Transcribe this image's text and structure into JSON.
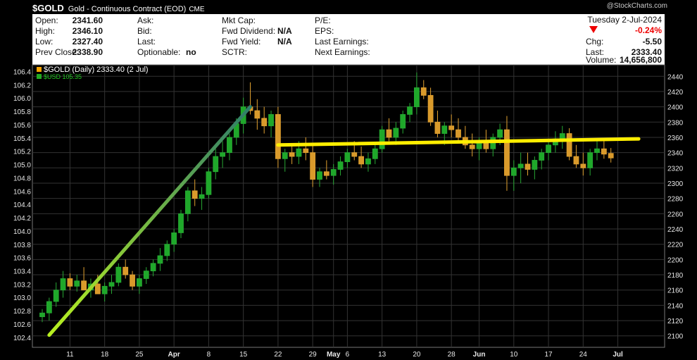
{
  "header": {
    "symbol": "$GOLD",
    "name": "Gold - Continuous Contract (EOD)",
    "exchange": "CME",
    "watermark": "@StockCharts.com"
  },
  "quote": {
    "open_label": "Open:",
    "open": "2341.60",
    "high_label": "High:",
    "high": "2346.10",
    "low_label": "Low:",
    "low": "2327.40",
    "prev_close_label": "Prev Close:",
    "prev_close": "2338.90",
    "ask_label": "Ask:",
    "bid_label": "Bid:",
    "last_label": "Last:",
    "optionable_label": "Optionable:",
    "optionable": "no",
    "mktcap_label": "Mkt Cap:",
    "fwd_div_label": "Fwd Dividend:",
    "fwd_div": "N/A",
    "fwd_yield_label": "Fwd Yield:",
    "fwd_yield": "N/A",
    "sctr_label": "SCTR:",
    "pe_label": "P/E:",
    "eps_label": "EPS:",
    "last_earnings_label": "Last Earnings:",
    "next_earnings_label": "Next Earnings:",
    "date": "Tuesday 2-Jul-2024",
    "pct_change": "-0.24%",
    "chg_label": "Chg:",
    "chg": "-5.50",
    "last_price_label": "Last:",
    "last_price": "2333.40",
    "volume_label": "Volume:",
    "volume": "14,656,800"
  },
  "chart_data": {
    "type": "candlestick",
    "legend": [
      {
        "name": "$GOLD (Daily) 2333.40 (2 Jul)",
        "color": "#ffffff"
      },
      {
        "name": "$USD 105.35",
        "color": "#22aa22"
      }
    ],
    "right_axis": {
      "ylim": [
        2085,
        2455
      ],
      "ticks": [
        2100,
        2120,
        2140,
        2160,
        2180,
        2200,
        2220,
        2240,
        2260,
        2280,
        2300,
        2320,
        2340,
        2360,
        2380,
        2400,
        2420,
        2440
      ]
    },
    "left_axis": {
      "ylim": [
        102.25,
        106.5
      ],
      "ticks": [
        "102.4",
        "102.6",
        "102.8",
        "103.0",
        "103.2",
        "103.4",
        "103.6",
        "103.8",
        "104.0",
        "104.2",
        "104.4",
        "104.6",
        "104.8",
        "105.0",
        "105.2",
        "105.4",
        "105.6",
        "105.8",
        "106.0",
        "106.2",
        "106.4"
      ]
    },
    "x_ticks": [
      {
        "label": "11",
        "idx": 4
      },
      {
        "label": "18",
        "idx": 9
      },
      {
        "label": "25",
        "idx": 14
      },
      {
        "label": "Apr",
        "idx": 19,
        "bold": true
      },
      {
        "label": "8",
        "idx": 24
      },
      {
        "label": "15",
        "idx": 29
      },
      {
        "label": "22",
        "idx": 34
      },
      {
        "label": "29",
        "idx": 39
      },
      {
        "label": "May",
        "idx": 42,
        "bold": true
      },
      {
        "label": "6",
        "idx": 44
      },
      {
        "label": "13",
        "idx": 49
      },
      {
        "label": "20",
        "idx": 54
      },
      {
        "label": "28",
        "idx": 59
      },
      {
        "label": "Jun",
        "idx": 63,
        "bold": true
      },
      {
        "label": "10",
        "idx": 68
      },
      {
        "label": "17",
        "idx": 73
      },
      {
        "label": "24",
        "idx": 78
      },
      {
        "label": "Jul",
        "idx": 83,
        "bold": true
      }
    ],
    "candles_gold": [
      [
        2125,
        2135,
        2118,
        2130
      ],
      [
        2130,
        2150,
        2120,
        2145
      ],
      [
        2145,
        2170,
        2138,
        2160
      ],
      [
        2160,
        2185,
        2150,
        2175
      ],
      [
        2175,
        2182,
        2160,
        2165
      ],
      [
        2165,
        2180,
        2158,
        2172
      ],
      [
        2172,
        2190,
        2165,
        2160
      ],
      [
        2160,
        2175,
        2150,
        2168
      ],
      [
        2168,
        2180,
        2160,
        2155
      ],
      [
        2155,
        2170,
        2145,
        2165
      ],
      [
        2165,
        2180,
        2155,
        2170
      ],
      [
        2170,
        2195,
        2165,
        2190
      ],
      [
        2190,
        2200,
        2175,
        2180
      ],
      [
        2180,
        2185,
        2160,
        2165
      ],
      [
        2165,
        2180,
        2155,
        2175
      ],
      [
        2175,
        2190,
        2168,
        2185
      ],
      [
        2185,
        2200,
        2178,
        2195
      ],
      [
        2195,
        2215,
        2185,
        2205
      ],
      [
        2205,
        2225,
        2198,
        2220
      ],
      [
        2220,
        2240,
        2210,
        2235
      ],
      [
        2235,
        2265,
        2228,
        2260
      ],
      [
        2260,
        2295,
        2250,
        2290
      ],
      [
        2290,
        2305,
        2270,
        2280
      ],
      [
        2280,
        2295,
        2265,
        2285
      ],
      [
        2285,
        2320,
        2280,
        2315
      ],
      [
        2315,
        2345,
        2305,
        2335
      ],
      [
        2335,
        2355,
        2320,
        2340
      ],
      [
        2340,
        2365,
        2330,
        2360
      ],
      [
        2360,
        2385,
        2350,
        2378
      ],
      [
        2378,
        2412,
        2365,
        2400
      ],
      [
        2400,
        2432,
        2390,
        2395
      ],
      [
        2395,
        2410,
        2370,
        2385
      ],
      [
        2385,
        2400,
        2365,
        2375
      ],
      [
        2375,
        2395,
        2360,
        2390
      ],
      [
        2390,
        2400,
        2320,
        2332
      ],
      [
        2332,
        2345,
        2315,
        2340
      ],
      [
        2340,
        2350,
        2325,
        2335
      ],
      [
        2335,
        2355,
        2325,
        2345
      ],
      [
        2345,
        2360,
        2330,
        2340
      ],
      [
        2340,
        2350,
        2295,
        2305
      ],
      [
        2305,
        2320,
        2295,
        2315
      ],
      [
        2315,
        2330,
        2305,
        2310
      ],
      [
        2310,
        2325,
        2298,
        2318
      ],
      [
        2318,
        2335,
        2310,
        2328
      ],
      [
        2328,
        2345,
        2320,
        2340
      ],
      [
        2340,
        2355,
        2330,
        2335
      ],
      [
        2335,
        2348,
        2320,
        2325
      ],
      [
        2325,
        2340,
        2315,
        2332
      ],
      [
        2332,
        2350,
        2325,
        2345
      ],
      [
        2345,
        2375,
        2340,
        2370
      ],
      [
        2370,
        2385,
        2355,
        2360
      ],
      [
        2360,
        2380,
        2350,
        2372
      ],
      [
        2372,
        2395,
        2365,
        2390
      ],
      [
        2390,
        2405,
        2380,
        2400
      ],
      [
        2400,
        2445,
        2390,
        2425
      ],
      [
        2425,
        2435,
        2410,
        2415
      ],
      [
        2415,
        2425,
        2375,
        2380
      ],
      [
        2380,
        2395,
        2360,
        2365
      ],
      [
        2365,
        2380,
        2350,
        2375
      ],
      [
        2375,
        2390,
        2360,
        2370
      ],
      [
        2370,
        2385,
        2355,
        2360
      ],
      [
        2360,
        2375,
        2345,
        2350
      ],
      [
        2350,
        2365,
        2335,
        2345
      ],
      [
        2345,
        2360,
        2330,
        2355
      ],
      [
        2355,
        2370,
        2340,
        2345
      ],
      [
        2345,
        2365,
        2335,
        2360
      ],
      [
        2360,
        2378,
        2350,
        2370
      ],
      [
        2370,
        2388,
        2290,
        2310
      ],
      [
        2310,
        2330,
        2290,
        2320
      ],
      [
        2320,
        2340,
        2300,
        2325
      ],
      [
        2325,
        2340,
        2310,
        2318
      ],
      [
        2318,
        2335,
        2305,
        2330
      ],
      [
        2330,
        2345,
        2318,
        2340
      ],
      [
        2340,
        2358,
        2330,
        2350
      ],
      [
        2350,
        2368,
        2340,
        2358
      ],
      [
        2358,
        2375,
        2345,
        2365
      ],
      [
        2365,
        2372,
        2330,
        2335
      ],
      [
        2335,
        2350,
        2320,
        2325
      ],
      [
        2325,
        2340,
        2310,
        2320
      ],
      [
        2320,
        2345,
        2310,
        2340
      ],
      [
        2340,
        2355,
        2330,
        2345
      ],
      [
        2345,
        2355,
        2332,
        2338
      ],
      [
        2339,
        2346,
        2327,
        2333
      ]
    ],
    "trendlines": [
      {
        "from": [
          1,
          2101
        ],
        "to": [
          30,
          2400
        ],
        "gradient": [
          "#b8f020",
          "#2e7d6a"
        ]
      },
      {
        "from": [
          34,
          2350
        ],
        "to": [
          86,
          2358
        ],
        "color": "#ffee00"
      }
    ]
  }
}
